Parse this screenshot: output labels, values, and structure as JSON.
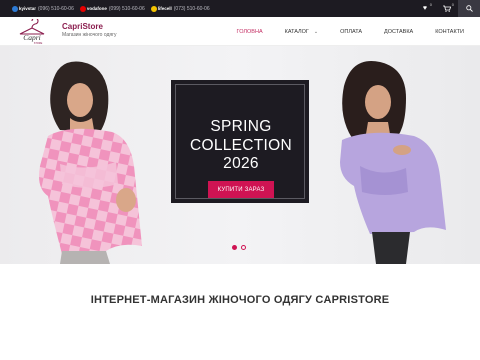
{
  "topbar": {
    "phones": [
      {
        "operator": "kyivstar",
        "number": "(096) 510-60-06",
        "color": "#2d7bd6"
      },
      {
        "operator": "vodafone",
        "number": "(099) 510-60-06",
        "color": "#e60000"
      },
      {
        "operator": "lifecell",
        "number": "(073) 510-60-06",
        "color": "#f5c400"
      }
    ],
    "wishlist_count": "0",
    "cart_count": "0"
  },
  "header": {
    "logo_text": "Capri",
    "logo_tagline": "STORE",
    "brand_name": "CapriStore",
    "brand_tagline": "Магазин жіночого одягу",
    "nav": [
      {
        "label": "ГОЛОВНА",
        "active": true
      },
      {
        "label": "КАТАЛОГ",
        "active": false
      },
      {
        "label": "ОПЛАТА",
        "active": false
      },
      {
        "label": "ДОСТАВКА",
        "active": false
      },
      {
        "label": "КОНТАКТИ",
        "active": false
      }
    ]
  },
  "hero": {
    "promo_line1": "SPRING",
    "promo_line2": "COLLECTION",
    "promo_line3": "2026",
    "button_label": "КУПИТИ ЗАРАЗ",
    "slide_count": 2,
    "active_slide": 1
  },
  "main": {
    "section_title": "ІНТЕРНЕТ-МАГАЗИН ЖІНОЧОГО ОДЯГУ CAPRISTORE"
  },
  "colors": {
    "accent": "#cf1353",
    "brand": "#8b1d4e",
    "dark": "#1d1b22"
  }
}
